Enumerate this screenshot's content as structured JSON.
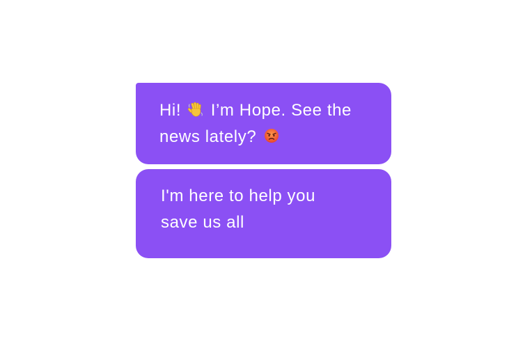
{
  "colors": {
    "bubble": "#8b50f4",
    "text": "#ffffff",
    "background": "#ffffff"
  },
  "messages": [
    {
      "line1_a": "Hi!",
      "line1_icon": "waving-hand-icon",
      "line1_b": "I’m Hope. See the",
      "line2_a": "news lately?",
      "line2_icon": "angry-face-icon"
    },
    {
      "line1": "I'm here to help you",
      "line2": "save us all"
    }
  ]
}
